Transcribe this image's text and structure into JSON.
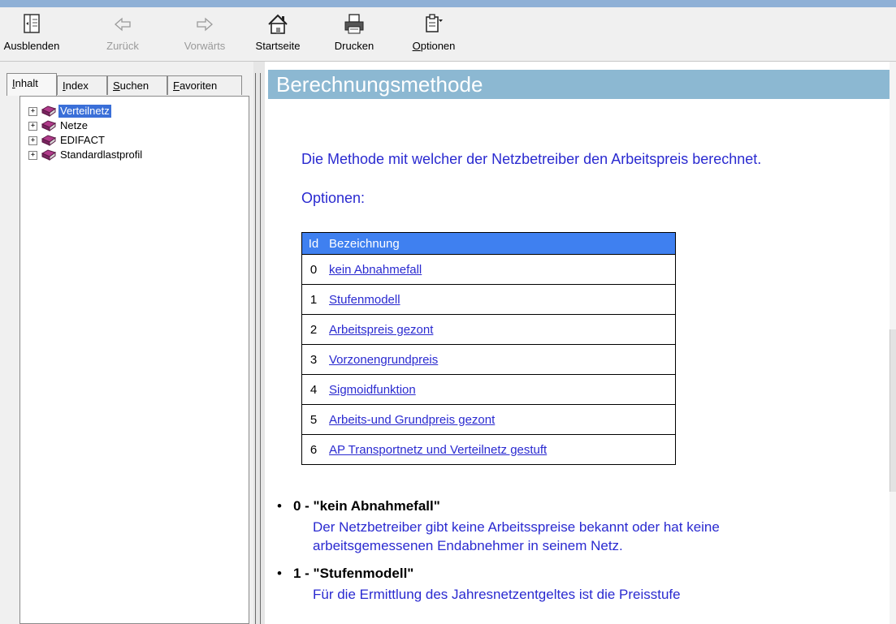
{
  "toolbar": {
    "hide_label": "Ausblenden",
    "back_label": "Zurück",
    "forward_label": "Vorwärts",
    "home_label": "Startseite",
    "print_label": "Drucken",
    "options_label_pre": "",
    "options_label_ul": "O",
    "options_label_post": "ptionen"
  },
  "tabs": [
    {
      "ul": "I",
      "rest": "nhalt"
    },
    {
      "ul": "I",
      "rest": "ndex"
    },
    {
      "ul": "S",
      "rest": "uchen"
    },
    {
      "ul": "F",
      "rest": "avoriten"
    }
  ],
  "tree": {
    "items": [
      {
        "label": "Verteilnetz",
        "selected": true
      },
      {
        "label": "Netze"
      },
      {
        "label": "EDIFACT"
      },
      {
        "label": "Standardlastprofil"
      }
    ]
  },
  "content": {
    "title": "Berechnungsmethode",
    "intro": "Die Methode mit welcher der Netzbetreiber den Arbeitspreis berechnet.",
    "options_label": "Optionen:",
    "table": {
      "col_id": "Id",
      "col_name": "Bezeichnung",
      "rows": [
        {
          "id": "0",
          "name": "kein Abnahmefall"
        },
        {
          "id": "1",
          "name": "Stufenmodell"
        },
        {
          "id": "2",
          "name": "Arbeitspreis gezont"
        },
        {
          "id": "3",
          "name": "Vorzonengrundpreis"
        },
        {
          "id": "4",
          "name": "Sigmoidfunktion"
        },
        {
          "id": "5",
          "name": "Arbeits-und Grundpreis gezont"
        },
        {
          "id": "6",
          "name": "AP Transportnetz und Verteilnetz gestuft"
        }
      ]
    },
    "bullets": [
      {
        "head": "0 - \"kein Abnahmefall\"",
        "desc_line1": "Der Netzbetreiber gibt keine Arbeitsspreise bekannt oder hat keine",
        "desc_line2": "arbeitsgemessenen Endabnehmer in seinem Netz."
      },
      {
        "head": "1 - \"Stufenmodell\"",
        "desc_line1": "Für die Ermittlung des Jahresnetzentgeltes  ist die Preisstufe",
        "desc_line2": ""
      }
    ]
  },
  "colors": {
    "title_bar": "#8cb8d2",
    "table_header": "#3f80f0",
    "link_text": "#2a2ad0",
    "selection": "#3a6fd8"
  }
}
